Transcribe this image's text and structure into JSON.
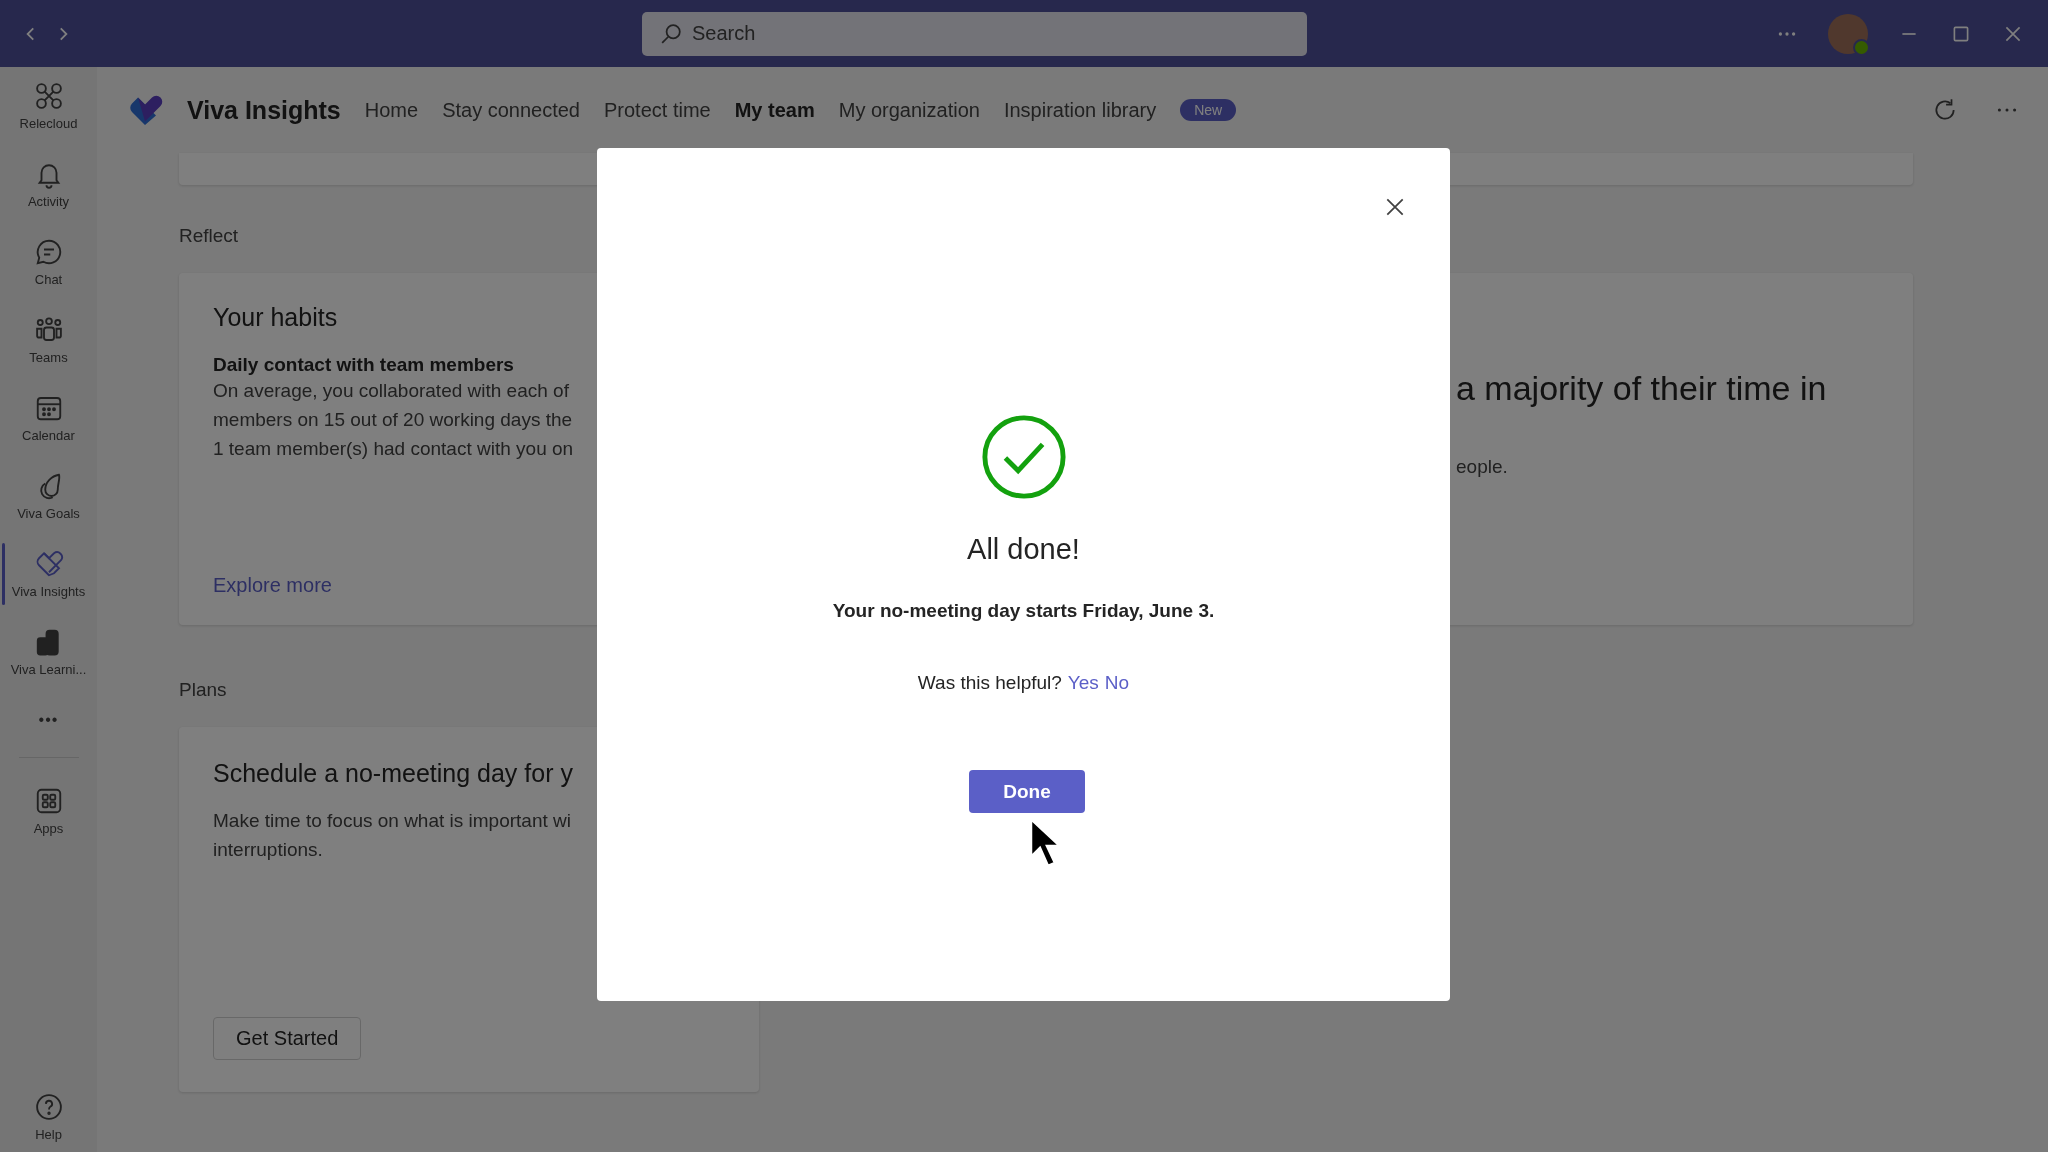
{
  "title_bar": {
    "search": {
      "placeholder": "Search"
    }
  },
  "rail": {
    "items": [
      {
        "label": "Relecloud",
        "selected": false
      },
      {
        "label": "Activity",
        "selected": false
      },
      {
        "label": "Chat",
        "selected": false
      },
      {
        "label": "Teams",
        "selected": false
      },
      {
        "label": "Calendar",
        "selected": false
      },
      {
        "label": "Viva Goals",
        "selected": false
      },
      {
        "label": "Viva Insights",
        "selected": true
      },
      {
        "label": "Viva Learni...",
        "selected": false
      }
    ],
    "more": "•••",
    "apps": {
      "label": "Apps"
    },
    "help": {
      "label": "Help"
    }
  },
  "header": {
    "app_title": "Viva Insights",
    "tabs": [
      {
        "label": "Home",
        "selected": false
      },
      {
        "label": "Stay connected",
        "selected": false
      },
      {
        "label": "Protect time",
        "selected": false
      },
      {
        "label": "My team",
        "selected": true
      },
      {
        "label": "My organization",
        "selected": false
      },
      {
        "label": "Inspiration library",
        "selected": false
      }
    ],
    "badge": "New"
  },
  "reflect": {
    "heading": "Reflect",
    "habits_card": {
      "title": "Your habits",
      "subtitle": "Daily contact with team members",
      "lines": [
        "On average, you collaborated with each of",
        "members on 15 out of 20 working days the",
        "1 team member(s) had contact with you on"
      ],
      "link": "Explore more"
    },
    "other_card": {
      "title": "a majority of their time in",
      "text": "eople."
    }
  },
  "plans": {
    "heading": "Plans",
    "card": {
      "title": "Schedule a no-meeting day for y",
      "lines": [
        "Make time to focus on what is important wi",
        "interruptions."
      ],
      "button": "Get Started"
    }
  },
  "dialog": {
    "title": "All done!",
    "message": "Your no-meeting day starts Friday, June 3.",
    "feedback": {
      "question": "Was this helpful?",
      "options": [
        "Yes",
        "No"
      ]
    },
    "button": "Done"
  }
}
